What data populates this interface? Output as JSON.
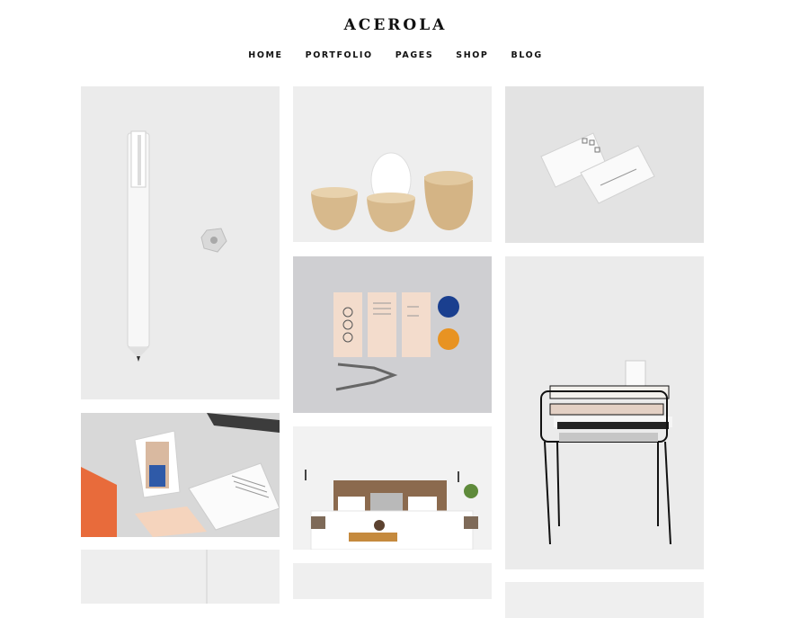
{
  "site": {
    "title": "ACEROLA"
  },
  "nav": {
    "items": [
      {
        "label": "HOME"
      },
      {
        "label": "PORTFOLIO"
      },
      {
        "label": "PAGES"
      },
      {
        "label": "SHOP"
      },
      {
        "label": "BLOG"
      }
    ]
  },
  "portfolio": {
    "items": [
      {
        "name": "pencil-sharpener"
      },
      {
        "name": "wooden-egg-cups"
      },
      {
        "name": "business-cards"
      },
      {
        "name": "stationery-set"
      },
      {
        "name": "side-table"
      },
      {
        "name": "photo-prints"
      },
      {
        "name": "bedroom"
      }
    ]
  }
}
